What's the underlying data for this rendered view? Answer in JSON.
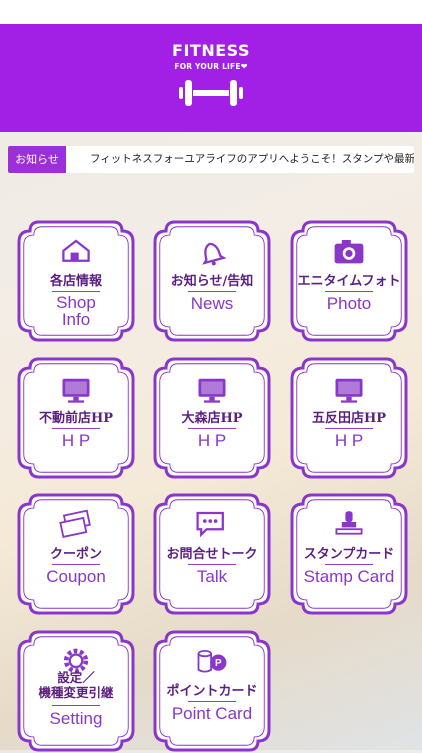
{
  "header": {
    "logo_title": "FITNESS",
    "logo_subtitle": "FOR YOUR LIFE",
    "bg_color": "#a21fe6"
  },
  "news": {
    "label": "お知らせ",
    "text": "フィットネスフォーユアライフのアプリへようこそ！スタンプや最新情"
  },
  "menu": [
    {
      "jp": "各店情報",
      "en_lines": [
        "Shop",
        "Info"
      ],
      "icon": "shop-icon"
    },
    {
      "jp": "お知らせ/告知",
      "en_lines": [
        "News"
      ],
      "icon": "bell-icon"
    },
    {
      "jp": "エニタイムフォト",
      "en_lines": [
        "Photo"
      ],
      "icon": "camera-icon"
    },
    {
      "jp": "不動前店HP",
      "en_lines": [
        "H P"
      ],
      "icon": "monitor-icon"
    },
    {
      "jp": "大森店HP",
      "en_lines": [
        "H P"
      ],
      "icon": "monitor-icon"
    },
    {
      "jp": "五反田店HP",
      "en_lines": [
        "H P"
      ],
      "icon": "monitor-icon"
    },
    {
      "jp": "クーポン",
      "en_lines": [
        "Coupon"
      ],
      "icon": "ticket-icon"
    },
    {
      "jp": "お問合せトーク",
      "en_lines": [
        "Talk"
      ],
      "icon": "chat-icon"
    },
    {
      "jp": "スタンプカード",
      "en_lines": [
        "Stamp Card"
      ],
      "icon": "stamp-icon"
    },
    {
      "jp": "設定／機種変更引継",
      "jp_lines": [
        "設定／",
        "機種変更引継"
      ],
      "en_lines": [
        "Setting"
      ],
      "icon": "gear-icon"
    },
    {
      "jp": "ポイントカード",
      "en_lines": [
        "Point Card"
      ],
      "icon": "coins-icon"
    }
  ],
  "colors": {
    "accent": "#9b30d9",
    "tile_border": "#8a37c9",
    "tile_text": "#5b1f82"
  }
}
